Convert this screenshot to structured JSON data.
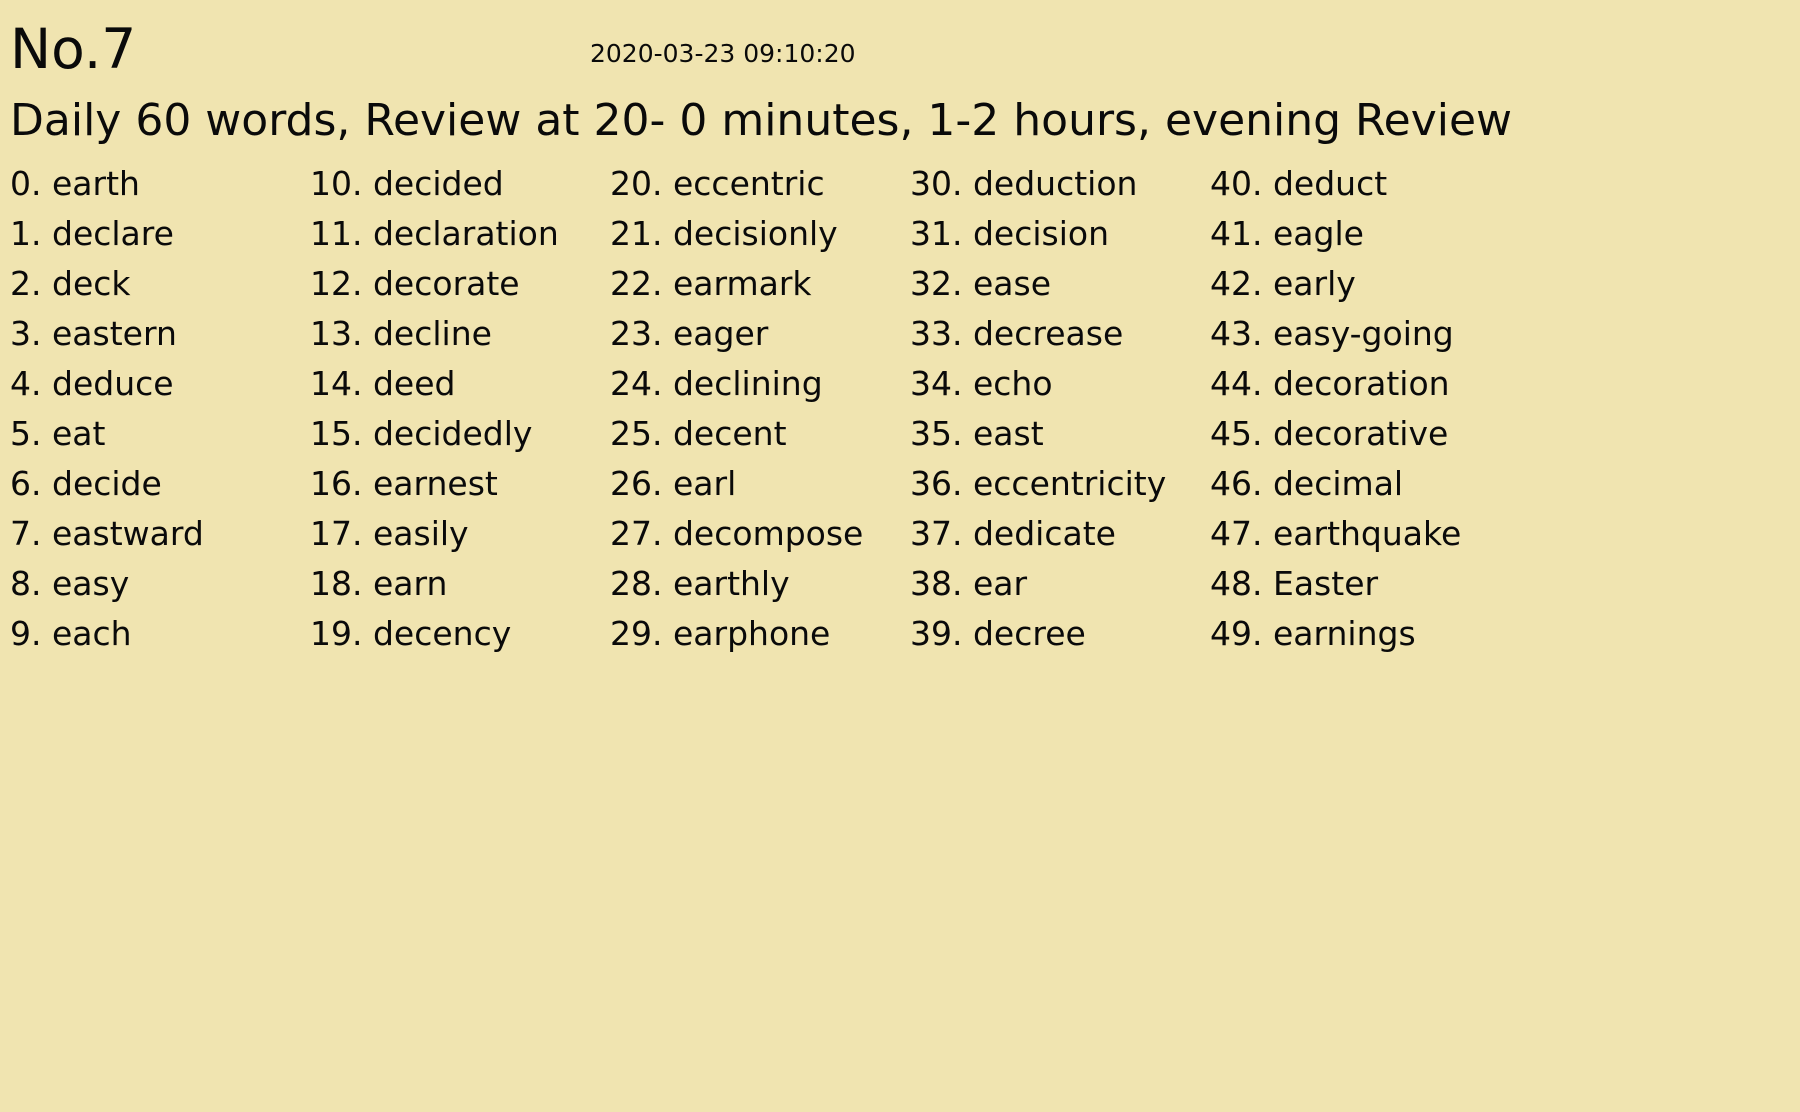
{
  "header": {
    "title": "No.7",
    "timestamp": "2020-03-23 09:10:20",
    "subtitle": "Daily 60 words, Review at 20- 0 minutes, 1-2 hours, evening Review"
  },
  "columns": [
    [
      {
        "index": "0.",
        "word": "earth"
      },
      {
        "index": "1.",
        "word": "declare"
      },
      {
        "index": "2.",
        "word": "deck"
      },
      {
        "index": "3.",
        "word": "eastern"
      },
      {
        "index": "4.",
        "word": "deduce"
      },
      {
        "index": "5.",
        "word": "eat"
      },
      {
        "index": "6.",
        "word": "decide"
      },
      {
        "index": "7.",
        "word": "eastward"
      },
      {
        "index": "8.",
        "word": "easy"
      },
      {
        "index": "9.",
        "word": "each"
      }
    ],
    [
      {
        "index": "10.",
        "word": "decided"
      },
      {
        "index": "11.",
        "word": "declaration"
      },
      {
        "index": "12.",
        "word": "decorate"
      },
      {
        "index": "13.",
        "word": "decline"
      },
      {
        "index": "14.",
        "word": "deed"
      },
      {
        "index": "15.",
        "word": "decidedly"
      },
      {
        "index": "16.",
        "word": "earnest"
      },
      {
        "index": "17.",
        "word": "easily"
      },
      {
        "index": "18.",
        "word": "earn"
      },
      {
        "index": "19.",
        "word": "decency"
      }
    ],
    [
      {
        "index": "20.",
        "word": "eccentric"
      },
      {
        "index": "21.",
        "word": "decisionly"
      },
      {
        "index": "22.",
        "word": "earmark"
      },
      {
        "index": "23.",
        "word": "eager"
      },
      {
        "index": "24.",
        "word": "declining"
      },
      {
        "index": "25.",
        "word": "decent"
      },
      {
        "index": "26.",
        "word": "earl"
      },
      {
        "index": "27.",
        "word": "decompose"
      },
      {
        "index": "28.",
        "word": "earthly"
      },
      {
        "index": "29.",
        "word": "earphone"
      }
    ],
    [
      {
        "index": "30.",
        "word": "deduction"
      },
      {
        "index": "31.",
        "word": "decision"
      },
      {
        "index": "32.",
        "word": "ease"
      },
      {
        "index": "33.",
        "word": "decrease"
      },
      {
        "index": "34.",
        "word": "echo"
      },
      {
        "index": "35.",
        "word": "east"
      },
      {
        "index": "36.",
        "word": "eccentricity"
      },
      {
        "index": "37.",
        "word": "dedicate"
      },
      {
        "index": "38.",
        "word": "ear"
      },
      {
        "index": "39.",
        "word": "decree"
      }
    ],
    [
      {
        "index": "40.",
        "word": "deduct"
      },
      {
        "index": "41.",
        "word": "eagle"
      },
      {
        "index": "42.",
        "word": "early"
      },
      {
        "index": "43.",
        "word": "easy-going"
      },
      {
        "index": "44.",
        "word": "decoration"
      },
      {
        "index": "45.",
        "word": "decorative"
      },
      {
        "index": "46.",
        "word": "decimal"
      },
      {
        "index": "47.",
        "word": "earthquake"
      },
      {
        "index": "48.",
        "word": "Easter"
      },
      {
        "index": "49.",
        "word": "earnings"
      }
    ]
  ],
  "colors": {
    "background": "#f0e4b0",
    "text": "#0a0a0a"
  }
}
